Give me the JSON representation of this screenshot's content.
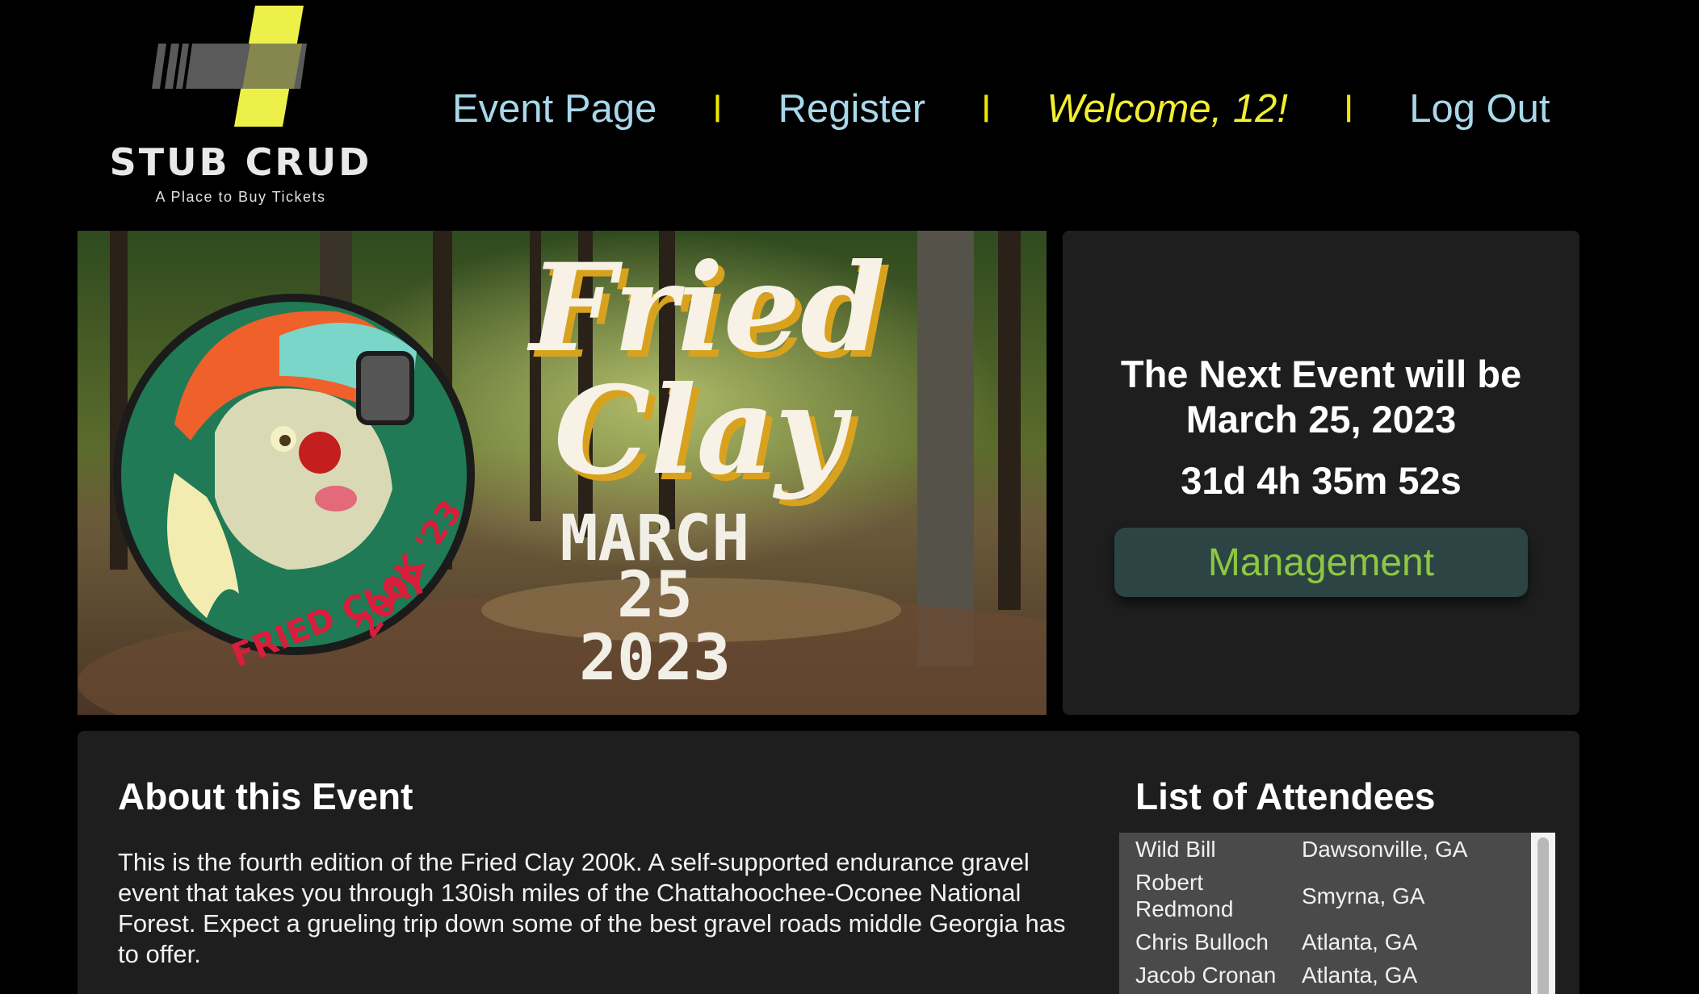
{
  "header": {
    "logo_title": "STUB CRUD",
    "logo_tagline": "A Place to Buy Tickets",
    "nav": {
      "event_page": "Event Page",
      "register": "Register",
      "welcome": "Welcome, 12!",
      "logout": "Log Out",
      "separator": "l"
    }
  },
  "hero": {
    "title_line1": "Fried",
    "title_line2": "Clay",
    "date_month": "MARCH",
    "date_day": "25",
    "date_year": "2023",
    "badge_text_1": "200K '23",
    "badge_text_2": "FRIED CLAY"
  },
  "next_event": {
    "line1": "The Next Event will be",
    "line2": "March 25, 2023",
    "countdown": "31d 4h 35m 52s",
    "management_label": "Management"
  },
  "about": {
    "title": "About this Event",
    "text": "This is the fourth edition of the Fried Clay 200k. A self-supported endurance gravel event that takes you through 130ish miles of the Chattahoochee-Oconee National Forest. Expect a grueling trip down some of the best gravel roads middle Georgia has to offer."
  },
  "attendees": {
    "title": "List of Attendees",
    "rows": [
      {
        "name": "Wild Bill",
        "city": "Dawsonville, GA"
      },
      {
        "name": "Robert Redmond",
        "city": "Smyrna, GA"
      },
      {
        "name": "Chris Bulloch",
        "city": "Atlanta, GA"
      },
      {
        "name": "Jacob Cronan",
        "city": "Atlanta, GA"
      }
    ]
  },
  "colors": {
    "nav_link": "#a8d8ea",
    "nav_separator": "#f2e600",
    "welcome": "#f2ee30",
    "management_bg": "#2c4544",
    "management_text": "#8ec742",
    "panel_bg": "#1e1e1e"
  }
}
